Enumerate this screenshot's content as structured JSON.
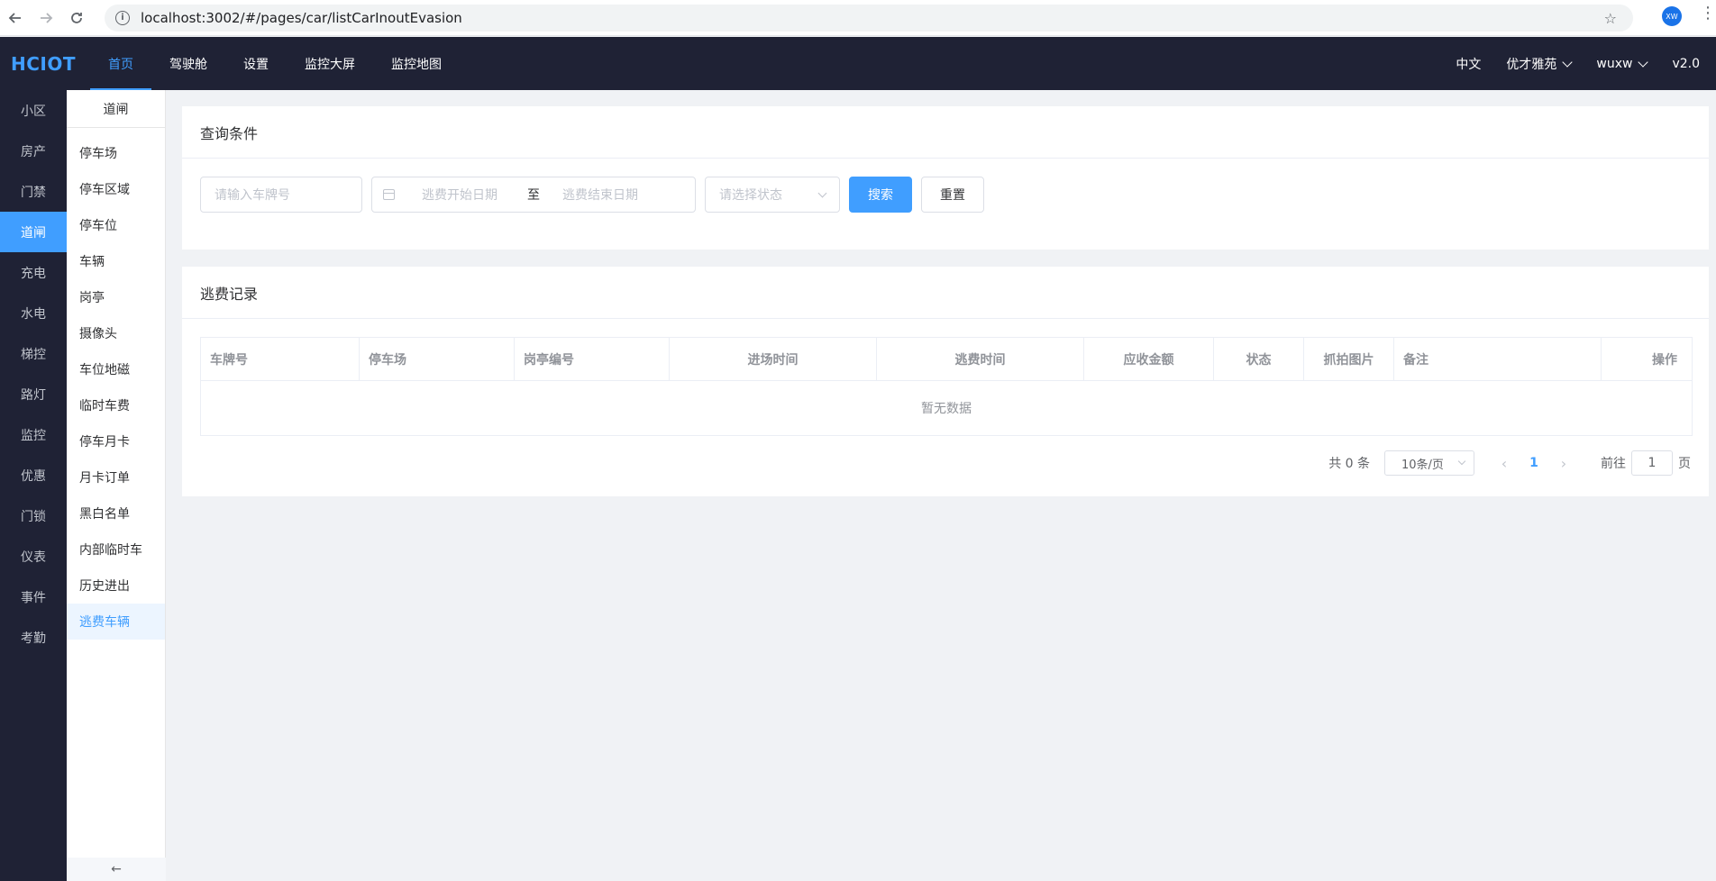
{
  "browser": {
    "url": "localhost:3002/#/pages/car/listCarInoutEvasion",
    "profile_initials": "XW"
  },
  "header": {
    "logo": "HCIOT",
    "nav": [
      {
        "label": "首页",
        "active": true
      },
      {
        "label": "驾驶舱",
        "active": false
      },
      {
        "label": "设置",
        "active": false
      },
      {
        "label": "监控大屏",
        "active": false
      },
      {
        "label": "监控地图",
        "active": false
      }
    ],
    "language": "中文",
    "community": "优才雅苑",
    "user": "wuxw",
    "version": "v2.0"
  },
  "side_primary": [
    {
      "label": "小区"
    },
    {
      "label": "房产"
    },
    {
      "label": "门禁"
    },
    {
      "label": "道闸"
    },
    {
      "label": "充电"
    },
    {
      "label": "水电"
    },
    {
      "label": "梯控"
    },
    {
      "label": "路灯"
    },
    {
      "label": "监控"
    },
    {
      "label": "优惠"
    },
    {
      "label": "门锁"
    },
    {
      "label": "仪表"
    },
    {
      "label": "事件"
    },
    {
      "label": "考勤"
    }
  ],
  "side_secondary": {
    "title": "道闸",
    "items": [
      {
        "label": "停车场"
      },
      {
        "label": "停车区域"
      },
      {
        "label": "停车位"
      },
      {
        "label": "车辆"
      },
      {
        "label": "岗亭"
      },
      {
        "label": "摄像头"
      },
      {
        "label": "车位地磁"
      },
      {
        "label": "临时车费"
      },
      {
        "label": "停车月卡"
      },
      {
        "label": "月卡订单"
      },
      {
        "label": "黑白名单"
      },
      {
        "label": "内部临时车"
      },
      {
        "label": "历史进出"
      },
      {
        "label": "逃费车辆"
      }
    ],
    "collapse_icon": "arrow-left-icon"
  },
  "query": {
    "title": "查询条件",
    "plate_placeholder": "请输入车牌号",
    "start_placeholder": "逃费开始日期",
    "range_separator": "至",
    "end_placeholder": "逃费结束日期",
    "status_placeholder": "请选择状态",
    "search_label": "搜索",
    "reset_label": "重置"
  },
  "records": {
    "title": "逃费记录",
    "columns": [
      {
        "label": "车牌号",
        "w": 176,
        "align": "left"
      },
      {
        "label": "停车场",
        "w": 172,
        "align": "left"
      },
      {
        "label": "岗亭编号",
        "w": 172,
        "align": "left"
      },
      {
        "label": "进场时间",
        "w": 230,
        "align": "center"
      },
      {
        "label": "逃费时间",
        "w": 230,
        "align": "center"
      },
      {
        "label": "应收金额",
        "w": 144,
        "align": "center"
      },
      {
        "label": "状态",
        "w": 100,
        "align": "center"
      },
      {
        "label": "抓拍图片",
        "w": 100,
        "align": "center"
      },
      {
        "label": "备注",
        "w": 230,
        "align": "left"
      },
      {
        "label": "操作",
        "w": 100,
        "align": "right"
      }
    ],
    "empty_text": "暂无数据",
    "pagination": {
      "total": "共 0 条",
      "page_size": "10条/页",
      "current_page": "1",
      "goto_label": "前往",
      "goto_value": "1",
      "goto_suffix": "页"
    }
  },
  "colors": {
    "primary": "#409eff",
    "header_bg": "#1f2235",
    "page_bg": "#f0f2f5"
  }
}
